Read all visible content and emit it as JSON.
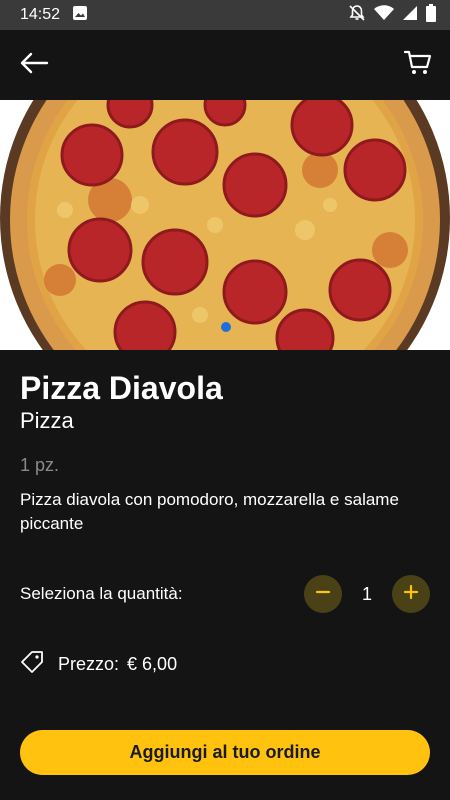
{
  "status_bar": {
    "time": "14:52",
    "icons": [
      "image-icon",
      "alarm-off-icon",
      "wifi-icon",
      "signal-icon",
      "battery-icon"
    ]
  },
  "app_bar": {
    "back_icon": "arrow-left-icon",
    "cart_icon": "cart-icon"
  },
  "product": {
    "name": "Pizza Diavola",
    "category": "Pizza",
    "unit": "1 pz.",
    "description": "Pizza diavola con pomodoro, mozzarella e salame piccante"
  },
  "quantity": {
    "label": "Seleziona la quantità:",
    "value": "1",
    "minus_icon": "minus-icon",
    "plus_icon": "plus-icon"
  },
  "price": {
    "icon": "tag-icon",
    "label": "Prezzo:",
    "value": "€ 6,00"
  },
  "cta": {
    "label": "Aggiungi al tuo ordine"
  },
  "colors": {
    "background": "#141414",
    "accent": "#ffc20e",
    "stepper": "#4a4216",
    "status_bar": "#3a3a3a"
  }
}
